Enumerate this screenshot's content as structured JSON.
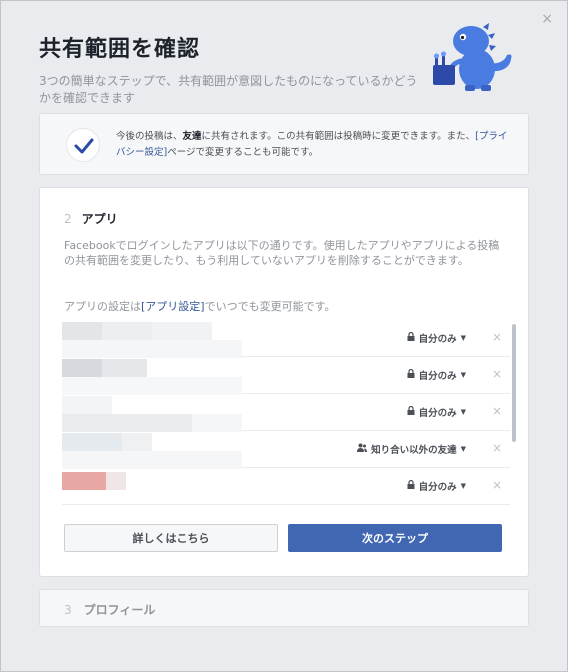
{
  "dialog": {
    "title": "共有範囲を確認",
    "subtitle": "3つの簡単なステップで、共有範囲が意図したものになっているかどうかを確認できます",
    "close_label": "×"
  },
  "notice": {
    "text_before": "今後の投稿は、",
    "audience": "友達",
    "text_middle": "に共有されます。この共有範囲は投稿時に変更できます。また、",
    "privacy_link": "[プライバシー設定]",
    "text_after": "ページで変更することも可能です。"
  },
  "step2": {
    "number": "2",
    "title": "アプリ",
    "description": "Facebookでログインしたアプリは以下の通りです。使用したアプリやアプリによる投稿の共有範囲を変更したり、もう利用していないアプリを削除することができます。",
    "settings_before": "アプリの設定は",
    "settings_link": "[アプリ設定]",
    "settings_after": "でいつでも変更可能です。",
    "apps": [
      {
        "privacy": "自分のみ",
        "icon": "lock-icon"
      },
      {
        "privacy": "自分のみ",
        "icon": "lock-icon"
      },
      {
        "privacy": "自分のみ",
        "icon": "lock-icon"
      },
      {
        "privacy": "知り合い以外の友達",
        "icon": "friends-icon"
      },
      {
        "privacy": "自分のみ",
        "icon": "lock-icon"
      }
    ],
    "remove_label": "×",
    "secondary_button": "詳しくはこちら",
    "primary_button": "次のステップ"
  },
  "step3": {
    "number": "3",
    "title": "プロフィール"
  },
  "colors": {
    "primary": "#4267b2",
    "link": "#365899",
    "mascot": "#4a7be0"
  }
}
